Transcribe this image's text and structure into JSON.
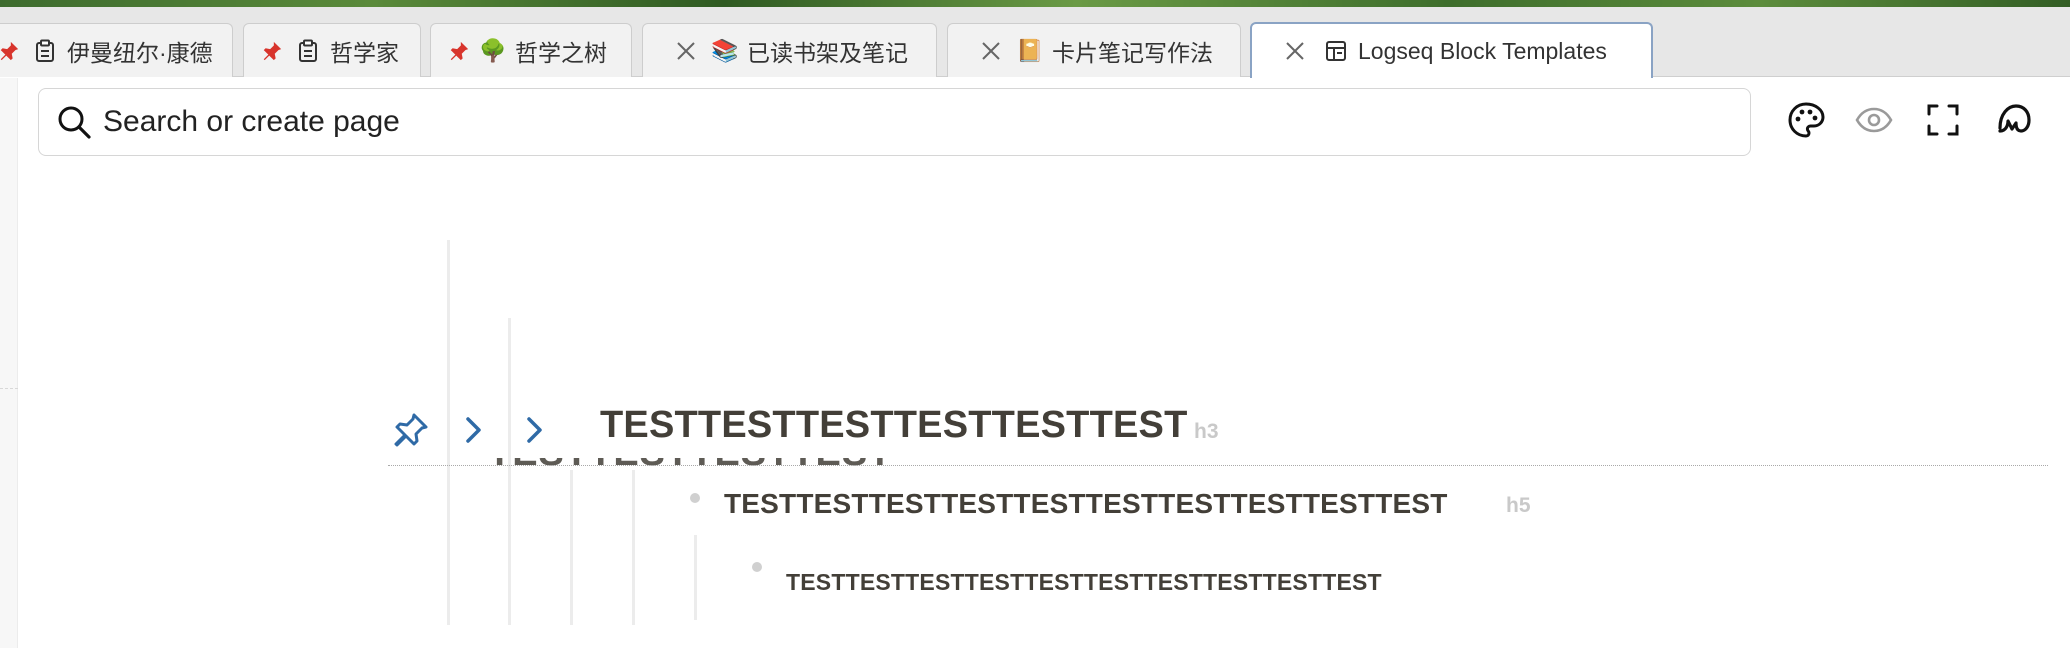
{
  "tabs": [
    {
      "label": "伊曼纽尔·康德",
      "icon": "clipboard-icon",
      "pinned": true
    },
    {
      "label": "哲学家",
      "icon": "clipboard-icon",
      "pinned": true
    },
    {
      "label": "哲学之树",
      "icon": "tree-emoji-icon",
      "glyph": "🌳",
      "pinned": true
    },
    {
      "label": "已读书架及笔记",
      "icon": "books-emoji-icon",
      "glyph": "📚",
      "pinned": false
    },
    {
      "label": "卡片笔记写作法",
      "icon": "card-emoji-icon",
      "glyph": "📔",
      "pinned": false
    },
    {
      "label": "Logseq Block Templates",
      "icon": "template-icon",
      "pinned": false,
      "active": true
    }
  ],
  "search": {
    "placeholder": "Search or create page"
  },
  "toolbar": [
    "palette-icon",
    "eye-icon",
    "fullscreen-icon",
    "logseq-logo-icon"
  ],
  "blocks": {
    "h3": {
      "text": "TESTTESTTESTTESTTESTTEST",
      "tag": "h3"
    },
    "h5": {
      "text": "TESTTESTTESTTESTTESTTESTTESTTESTTESTTEST",
      "tag": "h5"
    },
    "h6": {
      "text": "TESTTESTTESTTESTTESTTESTTESTTESTTESTTEST"
    },
    "ghost": {
      "text": "TESTTESTTESTTEST"
    }
  }
}
